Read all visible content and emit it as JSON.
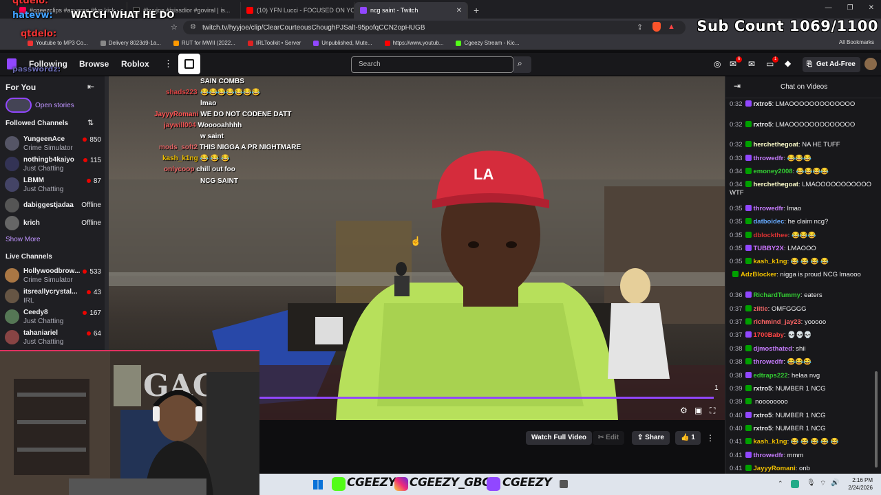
{
  "browser": {
    "tabs": [
      {
        "title": "#cgeezclips #asyarae #fyp kick - c...",
        "color": "#ff0050"
      },
      {
        "title": "#hyyjoe #isissdior #goviral | is...",
        "color": "#111"
      },
      {
        "title": "(10) YFN Lucci - FOCUSED ON YOU...",
        "color": "#ff0000"
      },
      {
        "title": "ncg saint - Twitch",
        "color": "#9147ff"
      }
    ],
    "url": "twitch.tv/hyyjoe/clip/ClearCourteousChoughPJSalt-95pofqCCN2opHUGB",
    "bookmarks": [
      {
        "label": "Youtube to MP3 Co...",
        "color": "#e33"
      },
      {
        "label": "Delivery 8023d9-1a...",
        "color": "#333"
      },
      {
        "label": "RUT for MWII (2022...",
        "color": "#f90"
      },
      {
        "label": "IRLToolkit • Server",
        "color": "#d22"
      },
      {
        "label": "Unpublished, Mute...",
        "color": "#9147ff"
      },
      {
        "label": "https://www.youtub...",
        "color": "#f00"
      },
      {
        "label": "Cgeezy Stream - Kic...",
        "color": "#53fc18"
      }
    ],
    "all_bookmarks": "All Bookmarks"
  },
  "overlay": {
    "user1": "qtdelo:",
    "user2": "hatevw:",
    "msg2": "WATCH WHAT HE DO",
    "user3": "qtdelo:",
    "user4": "passwordz:",
    "sub_count": "Sub Count 1069/1100"
  },
  "nav": {
    "following": "Following",
    "browse": "Browse",
    "roblox": "Roblox",
    "search_placeholder": "Search",
    "get_ad_free": "Get Ad-Free",
    "notif_count": "6",
    "whisper_count": "1"
  },
  "sidebar": {
    "for_you": "For You",
    "open_stories": "Open stories",
    "followed_channels": "Followed Channels",
    "followed": [
      {
        "name": "YungeenAce",
        "category": "Crime Simulator",
        "viewers": "850",
        "color": "#556"
      },
      {
        "name": "nothingb4kaiyo",
        "category": "Just Chatting",
        "viewers": "115",
        "color": "#335"
      },
      {
        "name": "LBMM",
        "category": "Just Chatting",
        "viewers": "87",
        "color": "#446"
      },
      {
        "name": "dabiggestjadaa",
        "category": "",
        "viewers": "Offline",
        "color": "#555"
      },
      {
        "name": "krich",
        "category": "",
        "viewers": "Offline",
        "color": "#666"
      }
    ],
    "show_more": "Show More",
    "live_channels": "Live Channels",
    "live": [
      {
        "name": "Hollywoodbrow...",
        "category": "Crime Simulator",
        "viewers": "533",
        "color": "#a74"
      },
      {
        "name": "itsreallycrystal...",
        "category": "IRL",
        "viewers": "43",
        "color": "#654"
      },
      {
        "name": "Ceedy8",
        "category": "Just Chatting",
        "viewers": "167",
        "color": "#575"
      },
      {
        "name": "tahaniariel",
        "category": "Just Chatting",
        "viewers": "64",
        "color": "#844"
      }
    ]
  },
  "video_chat": [
    {
      "user": "",
      "msg": "SAIN COMBS",
      "color": "#c33"
    },
    {
      "user": "shads223",
      "msg": "😂😂😂😂😂😂😂",
      "color": "#d44"
    },
    {
      "user": "",
      "msg": "lmao",
      "color": "#c33"
    },
    {
      "user": "JayyyRomani",
      "msg": "WE DO NOT CODENE DATT",
      "color": "#f55"
    },
    {
      "user": "jaywill004",
      "msg": "Wooooahhhh",
      "color": "#e55"
    },
    {
      "user": "",
      "msg": "w saint",
      "color": "#c33"
    },
    {
      "user": "mods_soft2",
      "msg": "THIS NIGGA A PR NIGHTMARE",
      "color": "#d66"
    },
    {
      "user": "kash_k1ng",
      "msg": "😂 😂 😂",
      "color": "#f0c000"
    },
    {
      "user": "onlycoop",
      "msg": "chill out foo",
      "color": "#e66"
    },
    {
      "user": "",
      "msg": "NCG SAINT",
      "color": "#c33"
    }
  ],
  "player": {
    "progress_fraction": 0.985,
    "clip_count": "1",
    "watch_full": "Watch Full Video",
    "edit": "Edit",
    "share": "Share",
    "likes": "1"
  },
  "chat": {
    "title": "Chat on Videos",
    "messages": [
      {
        "ts": "0:32",
        "user": "rxtro5",
        "msg": "LMAOOOOOOOOOOOOO",
        "color": "#efeff1"
      },
      {
        "ts": "0:32",
        "user": "rxtro5",
        "msg": "LMAOOOOOOOOOOOOO",
        "color": "#efeff1"
      },
      {
        "ts": "0:32",
        "user": "herchethegoat",
        "msg": "NA HE TUFF",
        "color": "#ffc"
      },
      {
        "ts": "0:33",
        "user": "throwedfr",
        "msg": "😂😂😂",
        "color": "#c77dff"
      },
      {
        "ts": "0:34",
        "user": "emoney2008",
        "msg": "😂😂😂😂",
        "color": "#3c3"
      },
      {
        "ts": "0:34",
        "user": "herchethegoat",
        "msg": "LMAOOOOOOOOOOO WTF",
        "color": "#ffc"
      },
      {
        "ts": "0:35",
        "user": "throwedfr",
        "msg": "lmao",
        "color": "#c77dff"
      },
      {
        "ts": "0:35",
        "user": "datboidec",
        "msg": "he claim ncg?",
        "color": "#6af"
      },
      {
        "ts": "0:35",
        "user": "dblockthee",
        "msg": "😂😂😂",
        "color": "#d33"
      },
      {
        "ts": "0:35",
        "user": "TUBBY2X",
        "msg": "LMAOOO",
        "color": "#c7f"
      },
      {
        "ts": "0:35",
        "user": "kash_k1ng",
        "msg": "😂 😂 😂 😂",
        "color": "#f0c000"
      },
      {
        "ts": "",
        "user": "AdzBlocker",
        "msg": "nigga is proud NCG lmaooo",
        "color": "#f0c000"
      },
      {
        "ts": "0:36",
        "user": "RichardTummy",
        "msg": "eaters",
        "color": "#3c3"
      },
      {
        "ts": "0:37",
        "user": "ziitie",
        "msg": "OMFGGGG",
        "color": "#e66"
      },
      {
        "ts": "0:37",
        "user": "richmind_jay23",
        "msg": "yooooo",
        "color": "#f66"
      },
      {
        "ts": "0:37",
        "user": "1700Baby",
        "msg": "💀💀💀",
        "color": "#f44"
      },
      {
        "ts": "0:38",
        "user": "djmosthated",
        "msg": "shii",
        "color": "#c77dff"
      },
      {
        "ts": "0:38",
        "user": "throwedfr",
        "msg": "😂😂😂",
        "color": "#c77dff"
      },
      {
        "ts": "0:38",
        "user": "edtraps222",
        "msg": "helaa nvg",
        "color": "#3c3"
      },
      {
        "ts": "0:39",
        "user": "rxtro5",
        "msg": "NUMBER 1 NCG",
        "color": "#efeff1"
      },
      {
        "ts": "0:39",
        "user": "",
        "msg": "noooooooo",
        "color": "#55f"
      },
      {
        "ts": "0:40",
        "user": "rxtro5",
        "msg": "NUMBER 1 NCG",
        "color": "#efeff1"
      },
      {
        "ts": "0:40",
        "user": "rxtro5",
        "msg": "NUMBER 1 NCG",
        "color": "#efeff1"
      },
      {
        "ts": "0:41",
        "user": "kash_k1ng",
        "msg": "😂 😂 😂 😂 😂",
        "color": "#f0c000"
      },
      {
        "ts": "0:41",
        "user": "throwedfr",
        "msg": "mmm",
        "color": "#c77dff"
      },
      {
        "ts": "0:41",
        "user": "JayyyRomani",
        "msg": "onb",
        "color": "#f0c000"
      }
    ]
  },
  "taskbar": {
    "kick": "CGEEZY",
    "insta": "CGEEZY_GBC",
    "twitch": "CGEEZY",
    "time": "2:16 PM",
    "date": "2/24/2026"
  }
}
